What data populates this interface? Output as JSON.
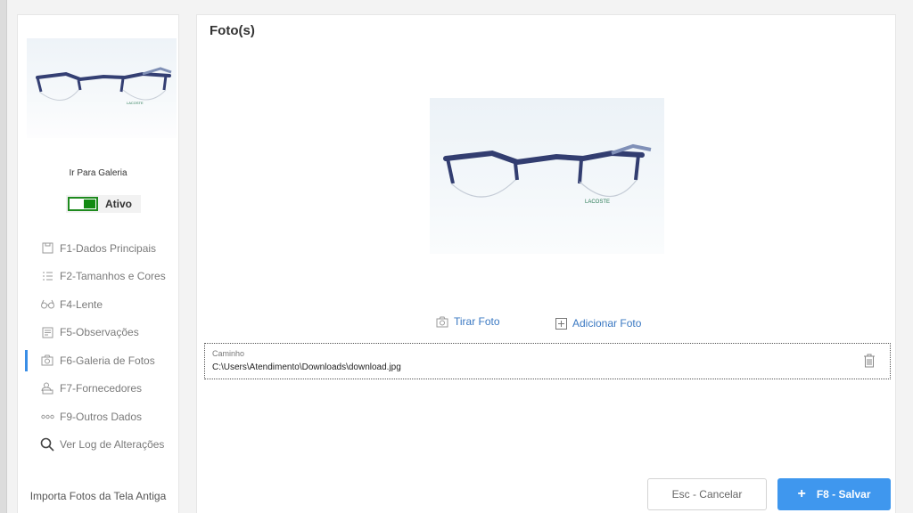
{
  "sidebar": {
    "gallery_link": "Ir Para Galeria",
    "status_label": "Ativo",
    "items": [
      {
        "label": "F1-Dados Principais",
        "icon": "document-icon"
      },
      {
        "label": "F2-Tamanhos  e Cores",
        "icon": "list-icon"
      },
      {
        "label": "F4-Lente",
        "icon": "glasses-icon"
      },
      {
        "label": "F5-Observações",
        "icon": "notes-icon"
      },
      {
        "label": "F6-Galeria de Fotos",
        "icon": "camera-icon",
        "active": true
      },
      {
        "label": "F7-Fornecedores",
        "icon": "supplier-icon"
      },
      {
        "label": "F9-Outros Dados",
        "icon": "dots-icon"
      },
      {
        "label": "Ver Log de Alterações",
        "icon": "search-icon"
      }
    ],
    "import_link": "Importa Fotos da Tela Antiga"
  },
  "main": {
    "title": "Foto(s)",
    "take_photo": "Tirar Foto",
    "add_photo": "Adicionar Foto",
    "path": {
      "label": "Caminho",
      "value": "C:\\Users\\Atendimento\\Downloads\\download.jpg"
    }
  },
  "buttons": {
    "cancel": "Esc - Cancelar",
    "save": "F8 - Salvar"
  },
  "colors": {
    "accent": "#3f97ee",
    "active_toggle": "#138a13",
    "link": "#3a78c2"
  },
  "photo": {
    "brand_text": "LACOSTE"
  }
}
